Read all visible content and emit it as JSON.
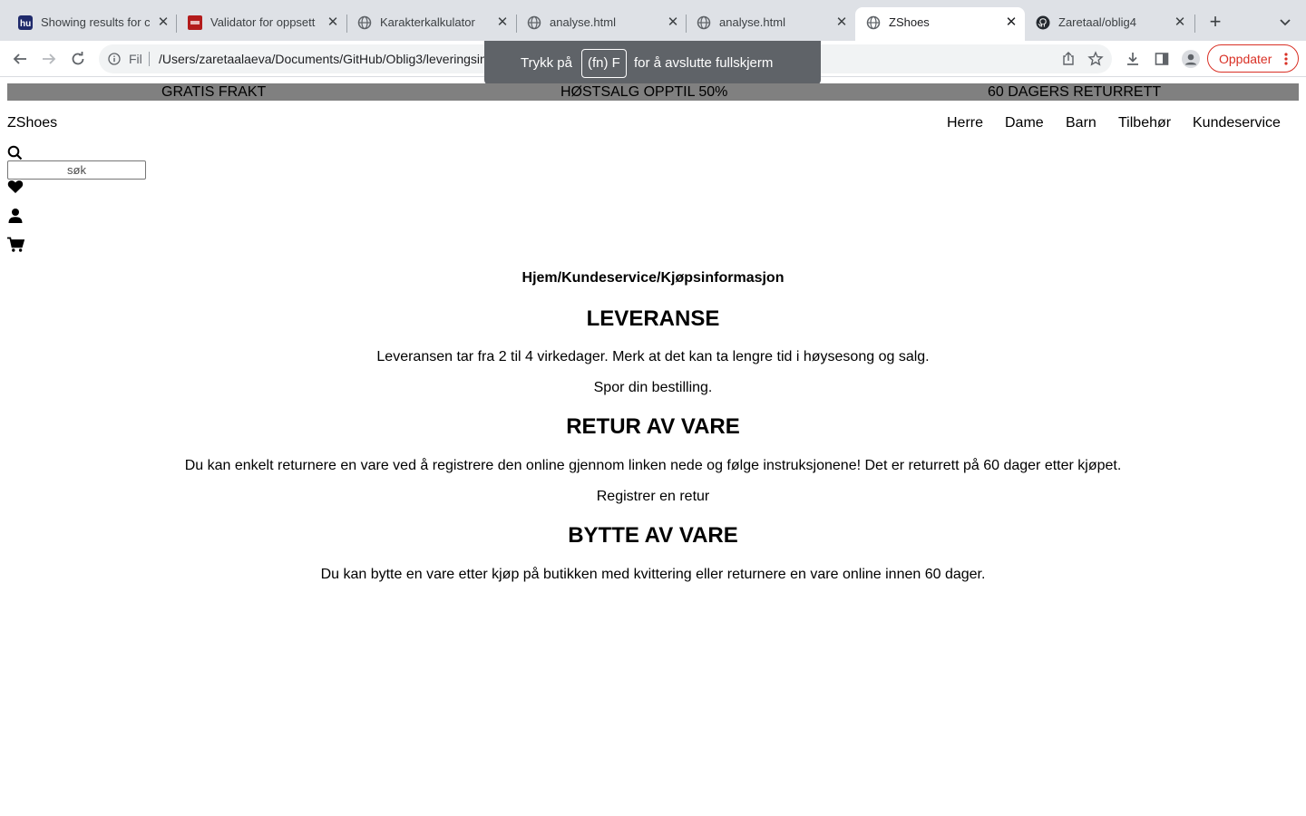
{
  "browser": {
    "tabs": [
      {
        "title": "Showing results for c",
        "favicon": "hu-logo-icon"
      },
      {
        "title": "Validator for oppsett",
        "favicon": "validator-icon"
      },
      {
        "title": "Karakterkalkulator",
        "favicon": "globe-icon"
      },
      {
        "title": "analyse.html",
        "favicon": "globe-icon"
      },
      {
        "title": "analyse.html",
        "favicon": "globe-icon"
      },
      {
        "title": "ZShoes",
        "favicon": "globe-icon",
        "active": true
      },
      {
        "title": "Zaretaal/oblig4",
        "favicon": "github-icon"
      }
    ],
    "omnibox": {
      "scheme_label": "Fil",
      "url": "/Users/zaretaalaeva/Documents/GitHub/Oblig3/leveringsinformasjon.html"
    },
    "update_button": "Oppdater",
    "fullscreen_toast": {
      "prefix": "Trykk på",
      "key": "(fn) F",
      "suffix": "for å avslutte fullskjerm"
    }
  },
  "promo": {
    "items": [
      "GRATIS FRAKT",
      "HØSTSALG OPPTIL 50%",
      "60 DAGERS RETURRETT"
    ],
    "background": "#808080"
  },
  "header": {
    "brand": "ZShoes",
    "nav": [
      "Herre",
      "Dame",
      "Barn",
      "Tilbehør",
      "Kundeservice"
    ],
    "search_placeholder": "søk"
  },
  "content": {
    "breadcrumb": "Hjem/Kundeservice/Kjøpsinformasjon",
    "sections": [
      {
        "heading": "LEVERANSE",
        "paragraphs": [
          "Leveransen tar fra 2 til 4 virkedager. Merk at det kan ta lengre tid i høysesong og salg.",
          "Spor din bestilling."
        ]
      },
      {
        "heading": "RETUR AV VARE",
        "paragraphs": [
          "Du kan enkelt returnere en vare ved å registrere den online gjennom linken nede og følge instruksjonene! Det er returrett på 60 dager etter kjøpet.",
          "Registrer en retur"
        ]
      },
      {
        "heading": "BYTTE AV VARE",
        "paragraphs": [
          "Du kan bytte en vare etter kjøp på butikken med kvittering eller returnere en vare online innen 60 dager."
        ]
      }
    ]
  }
}
